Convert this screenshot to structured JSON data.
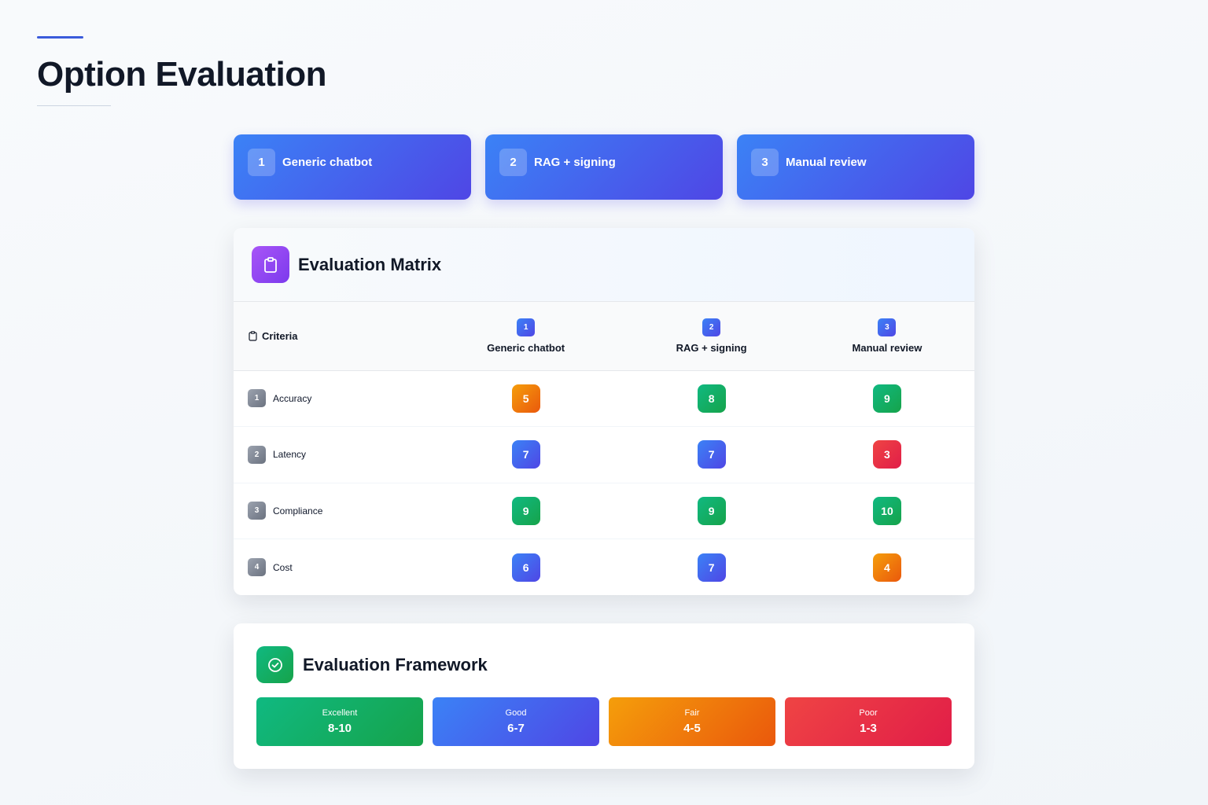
{
  "page": {
    "title": "Option Evaluation"
  },
  "options": [
    {
      "num": "1",
      "label": "Generic chatbot"
    },
    {
      "num": "2",
      "label": "RAG + signing"
    },
    {
      "num": "3",
      "label": "Manual review"
    }
  ],
  "matrix": {
    "title": "Evaluation Matrix",
    "criteria_header": "Criteria",
    "icon": "clipboard-icon",
    "rows": [
      {
        "num": "1",
        "label": "Accuracy",
        "scores": [
          "5",
          "8",
          "9"
        ],
        "levels": [
          "fair",
          "excellent",
          "excellent"
        ]
      },
      {
        "num": "2",
        "label": "Latency",
        "scores": [
          "7",
          "7",
          "3"
        ],
        "levels": [
          "good",
          "good",
          "poor"
        ]
      },
      {
        "num": "3",
        "label": "Compliance",
        "scores": [
          "9",
          "9",
          "10"
        ],
        "levels": [
          "excellent",
          "excellent",
          "excellent"
        ]
      },
      {
        "num": "4",
        "label": "Cost",
        "scores": [
          "6",
          "7",
          "4"
        ],
        "levels": [
          "good",
          "good",
          "fair"
        ]
      }
    ]
  },
  "framework": {
    "title": "Evaluation Framework",
    "icon": "check-circle-icon",
    "levels": [
      {
        "name": "Excellent",
        "range": "8-10",
        "color": "#10b981"
      },
      {
        "name": "Good",
        "range": "6-7",
        "color": "#3b82f6"
      },
      {
        "name": "Fair",
        "range": "4-5",
        "color": "#f59e0b"
      },
      {
        "name": "Poor",
        "range": "1-3",
        "color": "#ef4444"
      }
    ]
  }
}
